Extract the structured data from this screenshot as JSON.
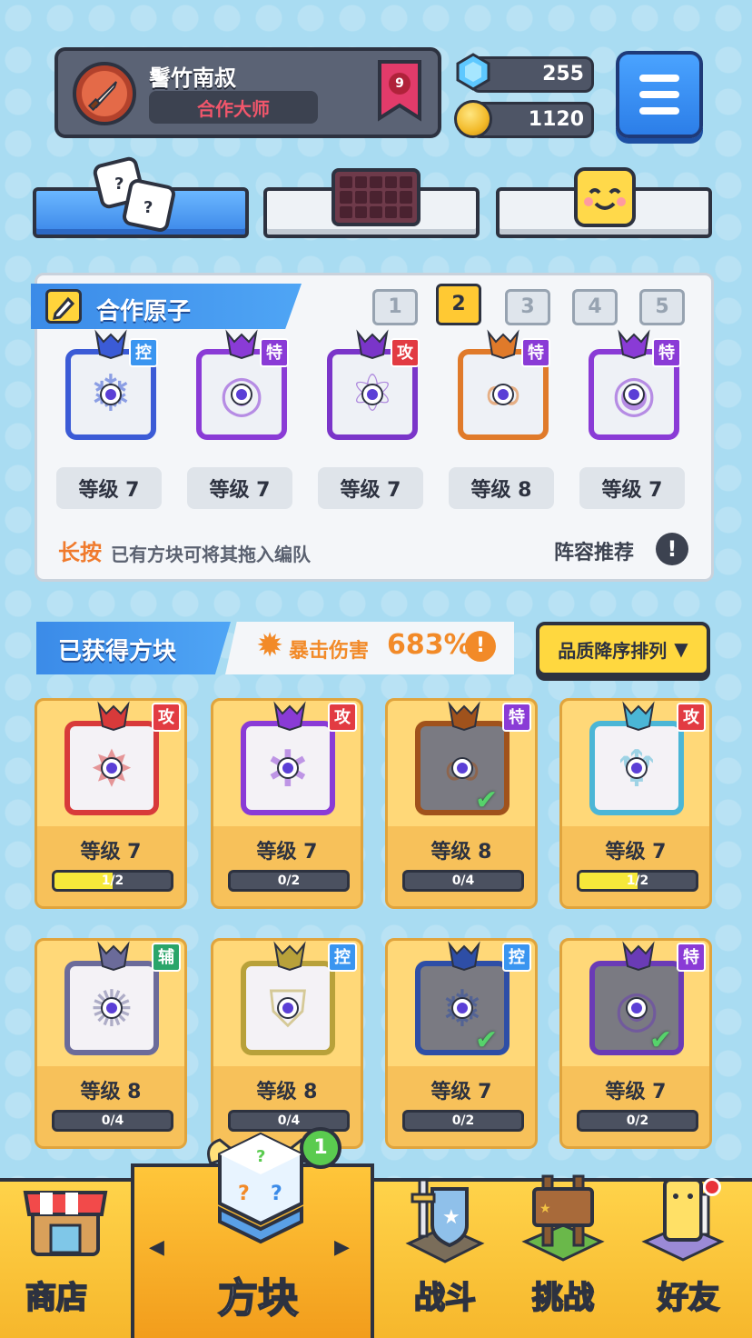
{
  "player": {
    "name": "鬐竹南叔",
    "title": "合作大师",
    "rank": "9"
  },
  "currency": {
    "gems": "255",
    "coins": "1120"
  },
  "team": {
    "title": "合作原子",
    "slots": [
      "1",
      "2",
      "3",
      "4",
      "5"
    ],
    "active_slot": 2,
    "cards": [
      {
        "tag": "控",
        "level": "等级 7",
        "color": "#3b5bd6",
        "glyph": "❄"
      },
      {
        "tag": "特",
        "level": "等级 7",
        "color": "#8a3bd6",
        "glyph": "◎"
      },
      {
        "tag": "攻",
        "level": "等级 7",
        "color": "#7a35c9",
        "glyph": "⚛"
      },
      {
        "tag": "特",
        "level": "等级 8",
        "color": "#e07a2a",
        "glyph": "∞"
      },
      {
        "tag": "特",
        "level": "等级 7",
        "color": "#8a3bd6",
        "glyph": "◉"
      }
    ],
    "hint_strong": "长按",
    "hint_text": "已有方块可将其拖入编队",
    "recommend": "阵容推荐",
    "info": "!"
  },
  "obtained": {
    "title": "已获得方块",
    "crit_label": "暴击伤害",
    "crit_value": "683%",
    "crit_info": "!",
    "sort_label": "品质降序排列",
    "sort_arrow": "▼",
    "cards": [
      {
        "tag": "攻",
        "level": "等级 7",
        "progress": "1/2",
        "fill": 0.5,
        "color": "#d83a3a",
        "glyph": "✸",
        "checked": false,
        "dark": false
      },
      {
        "tag": "攻",
        "level": "等级 7",
        "progress": "0/2",
        "fill": 0,
        "color": "#8a3bd6",
        "glyph": "✲",
        "checked": false,
        "dark": false
      },
      {
        "tag": "特",
        "level": "等级 8",
        "progress": "0/4",
        "fill": 0,
        "color": "#a0521c",
        "glyph": "∞",
        "checked": true,
        "dark": true
      },
      {
        "tag": "攻",
        "level": "等级 7",
        "progress": "1/2",
        "fill": 0.5,
        "color": "#4bb6d6",
        "glyph": "♆",
        "checked": false,
        "dark": false
      },
      {
        "tag": "辅",
        "level": "等级 8",
        "progress": "0/4",
        "fill": 0,
        "color": "#6b6b9a",
        "glyph": "✺",
        "checked": false,
        "dark": false
      },
      {
        "tag": "控",
        "level": "等级 8",
        "progress": "0/4",
        "fill": 0,
        "color": "#b8a13a",
        "glyph": "⛉",
        "checked": false,
        "dark": false
      },
      {
        "tag": "控",
        "level": "等级 7",
        "progress": "0/2",
        "fill": 0,
        "color": "#2e4ea6",
        "glyph": "❄",
        "checked": true,
        "dark": true
      },
      {
        "tag": "特",
        "level": "等级 7",
        "progress": "0/2",
        "fill": 0,
        "color": "#6a3bb6",
        "glyph": "◎",
        "checked": true,
        "dark": true
      }
    ]
  },
  "nav": {
    "shop": "商店",
    "blocks": "方块",
    "battle": "战斗",
    "challenge": "挑战",
    "friends": "好友",
    "blocks_badge": "1",
    "left_arrow": "◀",
    "right_arrow": "▶"
  },
  "colors": {
    "tag_ctrl": "#3a95f0",
    "tag_spec": "#8a3bd6",
    "tag_atk": "#e23b42",
    "tag_sup": "#2aa56a",
    "accent_blue": "#3b8be8",
    "accent_yellow": "#ffd83f"
  }
}
